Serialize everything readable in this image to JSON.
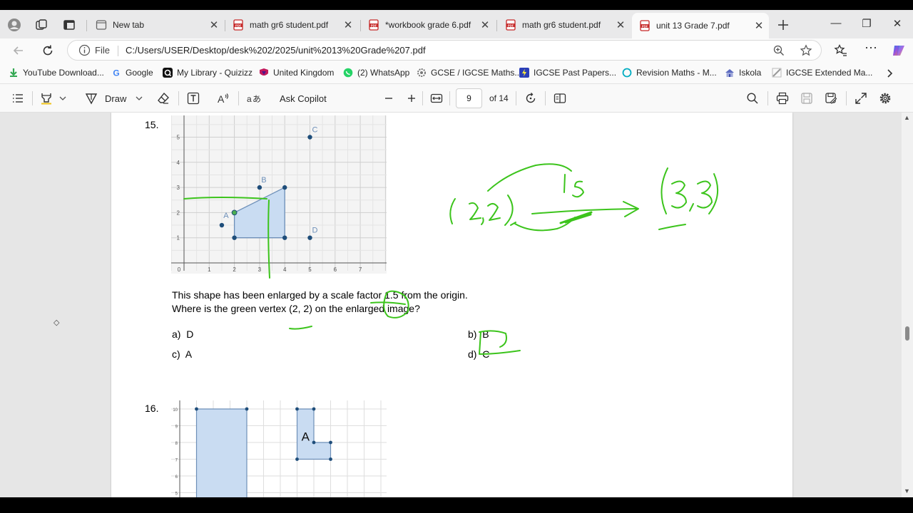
{
  "browser": {
    "tabs": [
      {
        "title": "New tab",
        "type": "newtab"
      },
      {
        "title": "math gr6 student.pdf",
        "type": "pdf"
      },
      {
        "title": "*workbook grade 6.pdf",
        "type": "pdf"
      },
      {
        "title": "math gr6 student.pdf",
        "type": "pdf"
      },
      {
        "title": "unit 13 Grade 7.pdf",
        "type": "pdf",
        "active": true
      }
    ],
    "address": {
      "scheme_label": "File",
      "url": "C:/Users/USER/Desktop/desk%202/2025/unit%2013%20Grade%207.pdf"
    },
    "bookmarks": [
      {
        "label": "YouTube Download...",
        "icon": "download-icon",
        "color": "#34a853"
      },
      {
        "label": "Google",
        "icon": "google-icon",
        "color": "#4285f4"
      },
      {
        "label": "My Library - Quizizz",
        "icon": "quizizz-icon",
        "color": "#111111"
      },
      {
        "label": "United Kingdom",
        "icon": "cambridge-icon",
        "color": "#c2185b"
      },
      {
        "label": "(2) WhatsApp",
        "icon": "whatsapp-icon",
        "color": "#25d366"
      },
      {
        "label": "GCSE / IGCSE Maths...",
        "icon": "gear-site-icon",
        "color": "#777777"
      },
      {
        "label": "IGCSE Past Papers...",
        "icon": "lightning-icon",
        "color": "#3f51b5"
      },
      {
        "label": "Revision Maths - M...",
        "icon": "circle-site-icon",
        "color": "#00acc1"
      },
      {
        "label": "Iskola",
        "icon": "school-icon",
        "color": "#5c6bc0"
      },
      {
        "label": "IGCSE Extended Ma...",
        "icon": "pdf-site-icon",
        "color": "#999999"
      }
    ]
  },
  "pdf_toolbar": {
    "draw_label": "Draw",
    "copilot_label": "Ask Copilot",
    "page_current": "9",
    "page_total": "of 14"
  },
  "document": {
    "q15": {
      "number": "15.",
      "text_line1": "This shape has been enlarged by a scale factor 1.5 from the origin.",
      "text_line2": "Where is the green vertex (2, 2) on the enlarged image?",
      "options": [
        {
          "key": "a)",
          "value": "D"
        },
        {
          "key": "b)",
          "value": "B"
        },
        {
          "key": "c)",
          "value": "A"
        },
        {
          "key": "d)",
          "value": "C"
        }
      ],
      "graph": {
        "x_ticks": [
          "0",
          "1",
          "2",
          "3",
          "4",
          "5",
          "6",
          "7"
        ],
        "y_ticks": [
          "1",
          "2",
          "3",
          "4",
          "5"
        ],
        "point_labels": [
          "A",
          "B",
          "C",
          "D"
        ]
      }
    },
    "q16": {
      "number": "16.",
      "shape_label": "A",
      "y_ticks": [
        "10",
        "9",
        "8",
        "7",
        "6",
        "5"
      ]
    }
  },
  "colors": {
    "ink_green": "#3cc41c",
    "shape_fill": "#c9dcf2",
    "shape_stroke": "#6d8fb8",
    "point": "#1e4d7a"
  }
}
